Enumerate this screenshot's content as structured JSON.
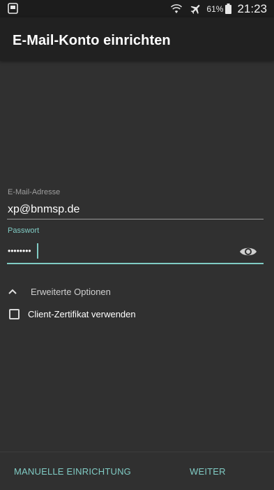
{
  "status_bar": {
    "battery_percent": "61%",
    "time": "21:23",
    "icons": [
      "app-notification-icon",
      "wifi-icon",
      "airplane-mode-icon",
      "battery-icon"
    ]
  },
  "app_bar": {
    "title": "E-Mail-Konto einrichten"
  },
  "form": {
    "email": {
      "label": "E-Mail-Adresse",
      "value": "xp@bnmsp.de"
    },
    "password": {
      "label": "Passwort",
      "value": "••••••••"
    },
    "advanced_label": "Erweiterte Optionen",
    "client_cert": {
      "label": "Client-Zertifikat verwenden",
      "checked": false
    }
  },
  "actions": {
    "manual_label": "MANUELLE EINRICHTUNG",
    "next_label": "WEITER"
  },
  "colors": {
    "accent": "#80cbc4",
    "background": "#303030",
    "app_bar": "#212121"
  }
}
